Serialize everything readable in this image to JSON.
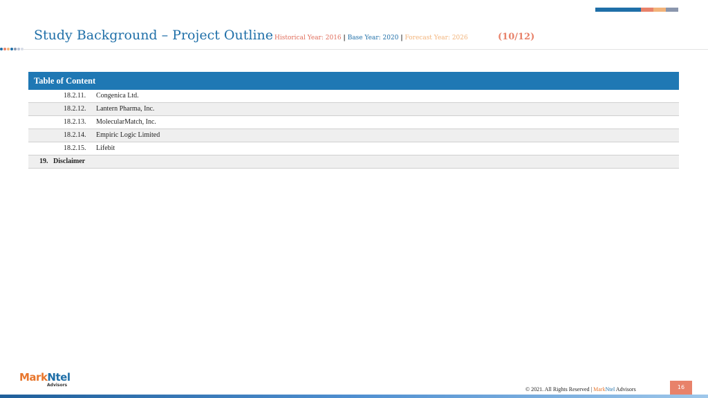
{
  "header": {
    "title": "Study Background – Project Outline",
    "historical": "Historical Year: 2016",
    "base": "Base Year: 2020",
    "forecast": "Forecast Year: 2026",
    "separator": "|",
    "page_count": "(10/12)",
    "accent_colors": [
      "#1f6fa8",
      "#e8826a",
      "#f2b37a",
      "#8a96ad"
    ]
  },
  "toc": {
    "heading": "Table of Content",
    "rows": [
      {
        "num": "18.2.11.",
        "text": "Congenica Ltd."
      },
      {
        "num": "18.2.12.",
        "text": "Lantern Pharma, Inc."
      },
      {
        "num": "18.2.13.",
        "text": "MolecularMatch, Inc."
      },
      {
        "num": "18.2.14.",
        "text": "Empiric Logic Limited"
      },
      {
        "num": "18.2.15.",
        "text": "Lifebit"
      },
      {
        "num": "19.",
        "text": "Disclaimer"
      }
    ]
  },
  "logo": {
    "mark": "Mark",
    "ntel": "Ntel",
    "sub": "Advisors"
  },
  "footer": {
    "copyright": "© 2021. All Rights Reserved | ",
    "brand_mark": "Mark",
    "brand_ntel": "Ntel",
    "brand_rest": " Advisors",
    "page_number": "16"
  }
}
